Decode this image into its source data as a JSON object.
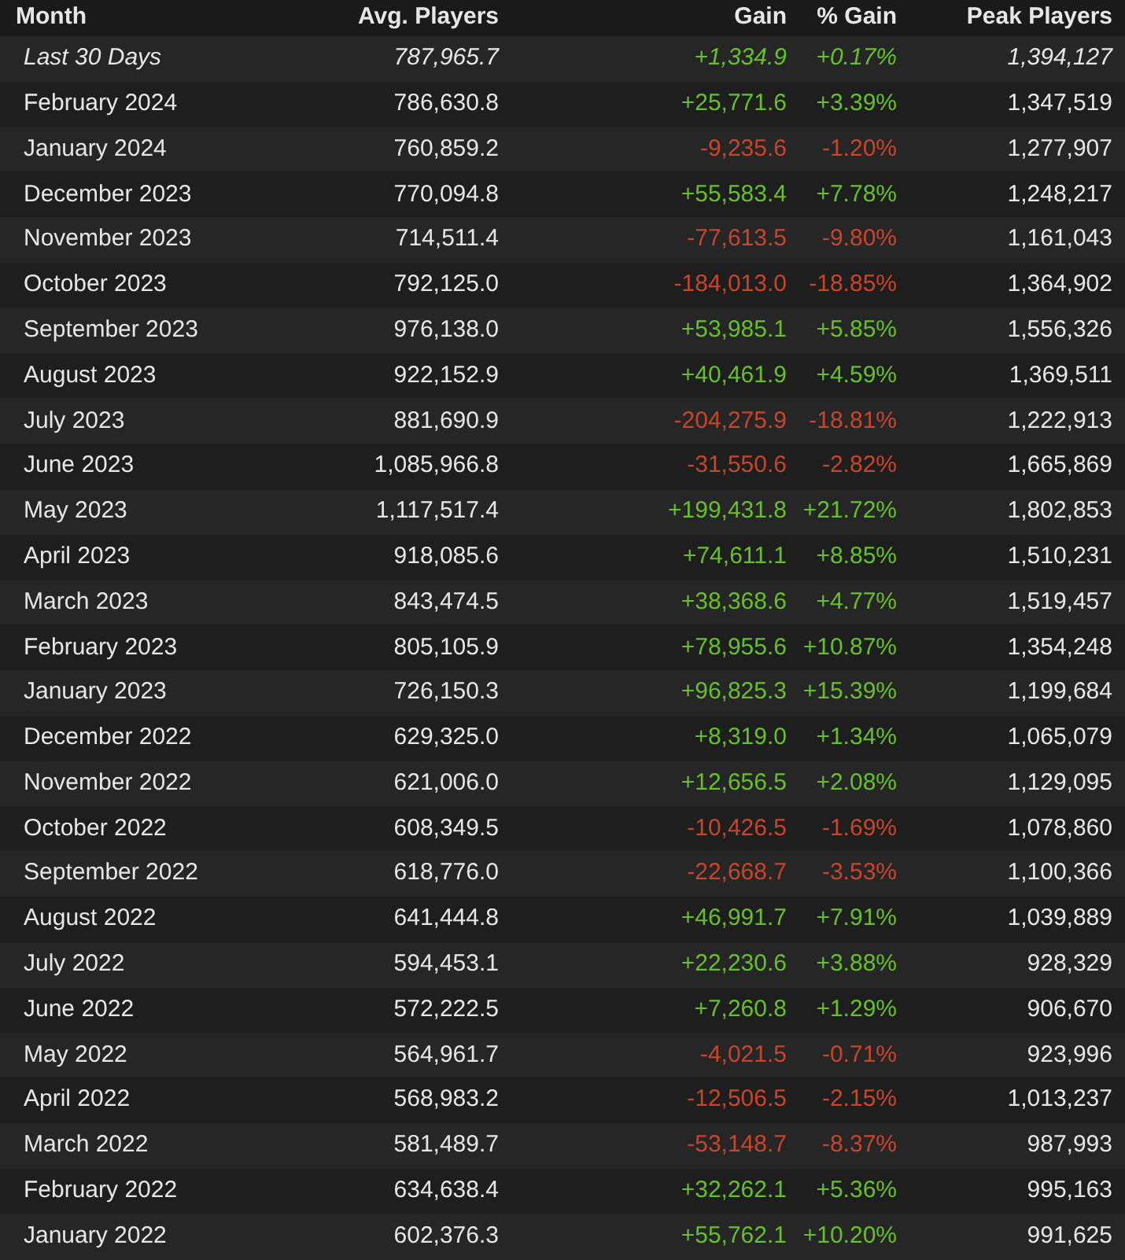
{
  "table": {
    "columns": [
      "Month",
      "Avg. Players",
      "Gain",
      "% Gain",
      "Peak Players"
    ],
    "rows": [
      {
        "italic": true,
        "color": "#66c02b",
        "cells": [
          "Last 30 Days",
          "787,965.7",
          "+1,334.9",
          "+0.17%",
          "1,394,127"
        ]
      },
      {
        "italic": false,
        "color": "#66c02b",
        "cells": [
          "February 2024",
          "786,630.8",
          "+25,771.6",
          "+3.39%",
          "1,347,519"
        ]
      },
      {
        "italic": false,
        "color": "#c9452a",
        "cells": [
          "January 2024",
          "760,859.2",
          "-9,235.6",
          "-1.20%",
          "1,277,907"
        ]
      },
      {
        "italic": false,
        "color": "#66c02b",
        "cells": [
          "December 2023",
          "770,094.8",
          "+55,583.4",
          "+7.78%",
          "1,248,217"
        ]
      },
      {
        "italic": false,
        "color": "#c9452a",
        "cells": [
          "November 2023",
          "714,511.4",
          "-77,613.5",
          "-9.80%",
          "1,161,043"
        ]
      },
      {
        "italic": false,
        "color": "#c9452a",
        "cells": [
          "October 2023",
          "792,125.0",
          "-184,013.0",
          "-18.85%",
          "1,364,902"
        ]
      },
      {
        "italic": false,
        "color": "#66c02b",
        "cells": [
          "September 2023",
          "976,138.0",
          "+53,985.1",
          "+5.85%",
          "1,556,326"
        ]
      },
      {
        "italic": false,
        "color": "#66c02b",
        "cells": [
          "August 2023",
          "922,152.9",
          "+40,461.9",
          "+4.59%",
          "1,369,511"
        ]
      },
      {
        "italic": false,
        "color": "#c9452a",
        "cells": [
          "July 2023",
          "881,690.9",
          "-204,275.9",
          "-18.81%",
          "1,222,913"
        ]
      },
      {
        "italic": false,
        "color": "#c9452a",
        "cells": [
          "June 2023",
          "1,085,966.8",
          "-31,550.6",
          "-2.82%",
          "1,665,869"
        ]
      },
      {
        "italic": false,
        "color": "#66c02b",
        "cells": [
          "May 2023",
          "1,117,517.4",
          "+199,431.8",
          "+21.72%",
          "1,802,853"
        ]
      },
      {
        "italic": false,
        "color": "#66c02b",
        "cells": [
          "April 2023",
          "918,085.6",
          "+74,611.1",
          "+8.85%",
          "1,510,231"
        ]
      },
      {
        "italic": false,
        "color": "#66c02b",
        "cells": [
          "March 2023",
          "843,474.5",
          "+38,368.6",
          "+4.77%",
          "1,519,457"
        ]
      },
      {
        "italic": false,
        "color": "#66c02b",
        "cells": [
          "February 2023",
          "805,105.9",
          "+78,955.6",
          "+10.87%",
          "1,354,248"
        ]
      },
      {
        "italic": false,
        "color": "#66c02b",
        "cells": [
          "January 2023",
          "726,150.3",
          "+96,825.3",
          "+15.39%",
          "1,199,684"
        ]
      },
      {
        "italic": false,
        "color": "#66c02b",
        "cells": [
          "December 2022",
          "629,325.0",
          "+8,319.0",
          "+1.34%",
          "1,065,079"
        ]
      },
      {
        "italic": false,
        "color": "#66c02b",
        "cells": [
          "November 2022",
          "621,006.0",
          "+12,656.5",
          "+2.08%",
          "1,129,095"
        ]
      },
      {
        "italic": false,
        "color": "#c9452a",
        "cells": [
          "October 2022",
          "608,349.5",
          "-10,426.5",
          "-1.69%",
          "1,078,860"
        ]
      },
      {
        "italic": false,
        "color": "#c9452a",
        "cells": [
          "September 2022",
          "618,776.0",
          "-22,668.7",
          "-3.53%",
          "1,100,366"
        ]
      },
      {
        "italic": false,
        "color": "#66c02b",
        "cells": [
          "August 2022",
          "641,444.8",
          "+46,991.7",
          "+7.91%",
          "1,039,889"
        ]
      },
      {
        "italic": false,
        "color": "#66c02b",
        "cells": [
          "July 2022",
          "594,453.1",
          "+22,230.6",
          "+3.88%",
          "928,329"
        ]
      },
      {
        "italic": false,
        "color": "#66c02b",
        "cells": [
          "June 2022",
          "572,222.5",
          "+7,260.8",
          "+1.29%",
          "906,670"
        ]
      },
      {
        "italic": false,
        "color": "#c9452a",
        "cells": [
          "May 2022",
          "564,961.7",
          "-4,021.5",
          "-0.71%",
          "923,996"
        ]
      },
      {
        "italic": false,
        "color": "#c9452a",
        "cells": [
          "April 2022",
          "568,983.2",
          "-12,506.5",
          "-2.15%",
          "1,013,237"
        ]
      },
      {
        "italic": false,
        "color": "#c9452a",
        "cells": [
          "March 2022",
          "581,489.7",
          "-53,148.7",
          "-8.37%",
          "987,993"
        ]
      },
      {
        "italic": false,
        "color": "#66c02b",
        "cells": [
          "February 2022",
          "634,638.4",
          "+32,262.1",
          "+5.36%",
          "995,163"
        ]
      },
      {
        "italic": false,
        "color": "#66c02b",
        "cells": [
          "January 2022",
          "602,376.3",
          "+55,762.1",
          "+10.20%",
          "991,625"
        ]
      }
    ]
  }
}
